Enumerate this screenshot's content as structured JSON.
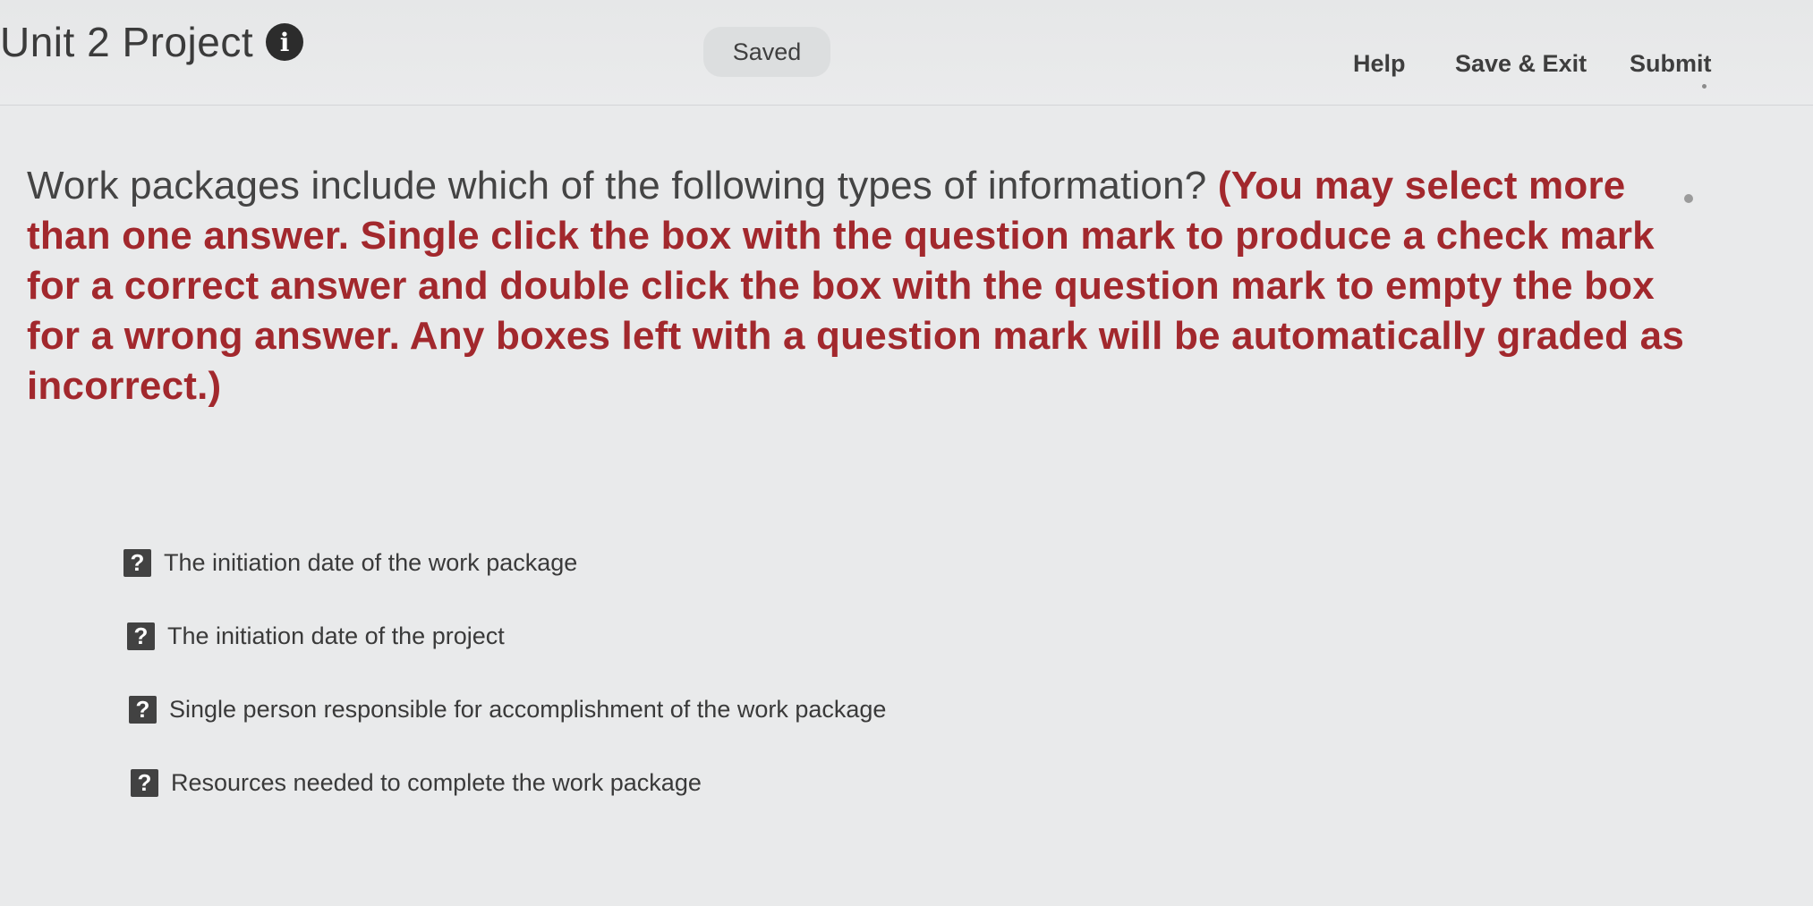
{
  "header": {
    "title": "Unit 2 Project",
    "info_icon": "info-icon",
    "status": "Saved",
    "nav": {
      "help": "Help",
      "save_exit": "Save & Exit",
      "submit": "Submit"
    }
  },
  "question": {
    "text": "Work packages include which of the following types of information?",
    "instruction": "(You may select more than one answer. Single click the box with the question mark to produce a check mark for a correct answer and double click the box with the question mark to empty the box for a wrong answer. Any boxes left with a question mark will be automatically graded as incorrect.)"
  },
  "answers": [
    {
      "marker": "?",
      "label": "The initiation date of the work package"
    },
    {
      "marker": "?",
      "label": "The initiation date of the project"
    },
    {
      "marker": "?",
      "label": "Single person responsible for accomplishment of the work package"
    },
    {
      "marker": "?",
      "label": "Resources needed to complete the work package"
    }
  ],
  "colors": {
    "instruction_red": "#a2282d",
    "text_dark": "#444444",
    "checkbox_dark": "#424242"
  }
}
